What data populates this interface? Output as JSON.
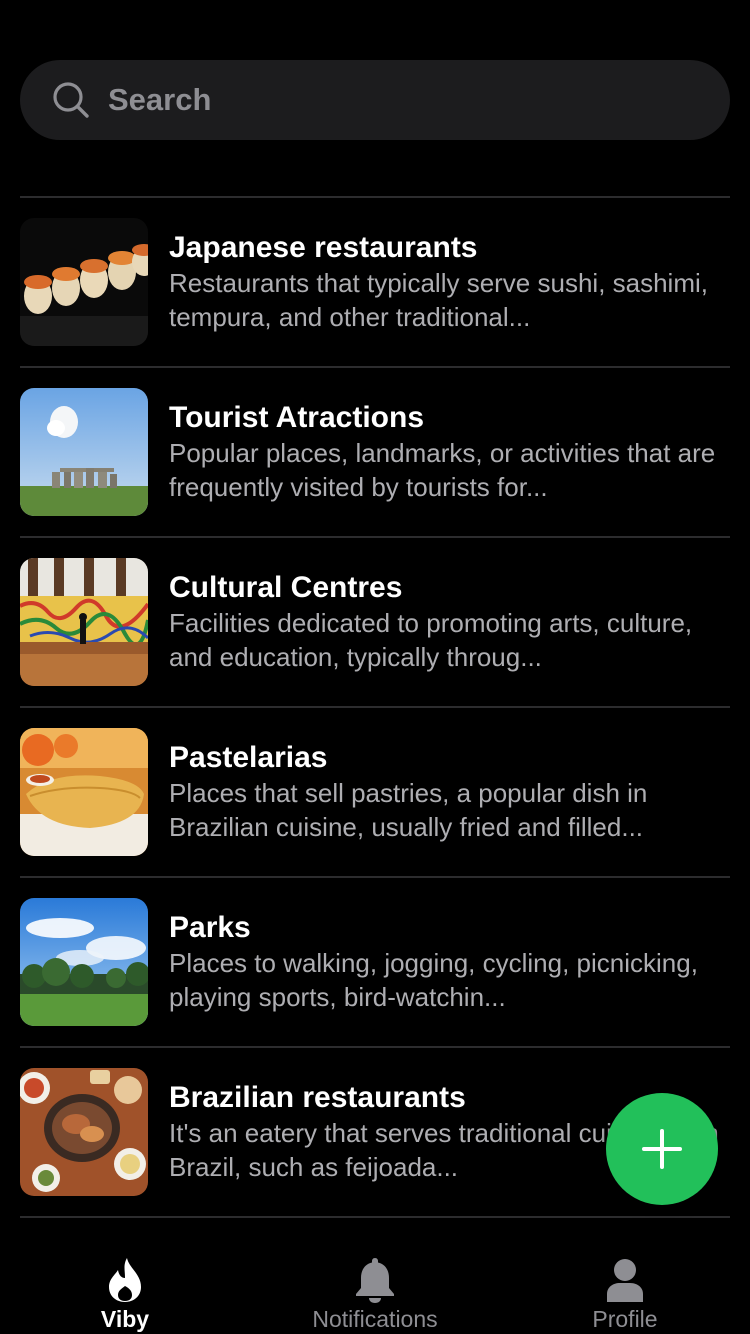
{
  "search": {
    "placeholder": "Search"
  },
  "categories": [
    {
      "title": "Japanese restaurants",
      "description": "Restaurants that typically serve sushi, sashimi, tempura, and other traditional...",
      "image": "sushi-photo"
    },
    {
      "title": "Tourist Atractions",
      "description": "Popular places, landmarks, or activities that are frequently visited by tourists for...",
      "image": "stonehenge-photo"
    },
    {
      "title": "Cultural Centres",
      "description": "Facilities dedicated to promoting arts, culture, and education, typically throug...",
      "image": "gallery-photo"
    },
    {
      "title": "Pastelarias",
      "description": "Places that sell pastries, a popular dish in Brazilian cuisine, usually fried and filled...",
      "image": "pastel-photo"
    },
    {
      "title": "Parks",
      "description": "Places to walking, jogging, cycling, picnicking, playing sports, bird-watchin...",
      "image": "park-photo"
    },
    {
      "title": "Brazilian restaurants",
      "description": "It's an eatery that serves traditional cuisine from Brazil, such as feijoada...",
      "image": "brazilian-food-photo"
    }
  ],
  "fab": {
    "icon": "plus-icon",
    "color": "#22c05a"
  },
  "tabs": [
    {
      "label": "Viby",
      "icon": "flame-icon",
      "active": true
    },
    {
      "label": "Notifications",
      "icon": "bell-icon",
      "active": false
    },
    {
      "label": "Profile",
      "icon": "person-icon",
      "active": false
    }
  ],
  "colors": {
    "background": "#000000",
    "search_field": "#1c1c1e",
    "divider": "#2c2c2e",
    "secondary_text": "#aeaeb2",
    "inactive": "#8e8e93"
  }
}
